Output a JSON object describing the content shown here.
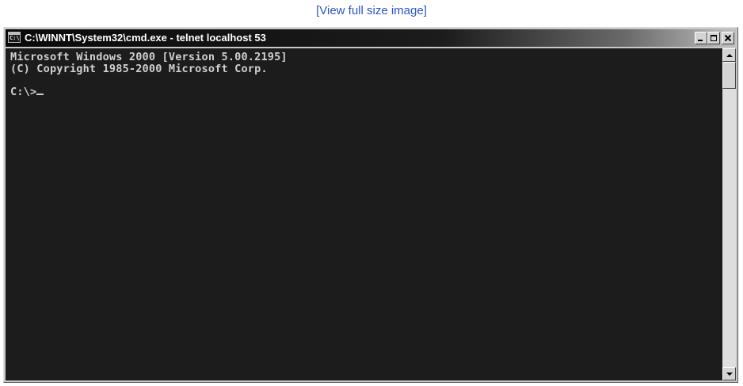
{
  "header": {
    "fullsize_link": "[View full size image]"
  },
  "window": {
    "title": "C:\\WINNT\\System32\\cmd.exe - telnet localhost 53",
    "app_icon": "cmd-console-icon",
    "buttons": {
      "minimize": "minimize-icon",
      "restore": "restore-icon",
      "close": "close-icon"
    }
  },
  "console": {
    "lines": [
      "Microsoft Windows 2000 [Version 5.00.2195]",
      "(C) Copyright 1985-2000 Microsoft Corp."
    ],
    "prompt": "C:\\>"
  },
  "scrollbar": {
    "up_icon": "arrow-up-icon",
    "down_icon": "arrow-down-icon"
  },
  "colors": {
    "link": "#2a55c8",
    "console_bg": "#1c1c1c",
    "console_text": "#d0d0d0",
    "titlebar": "#0a0a0a"
  }
}
